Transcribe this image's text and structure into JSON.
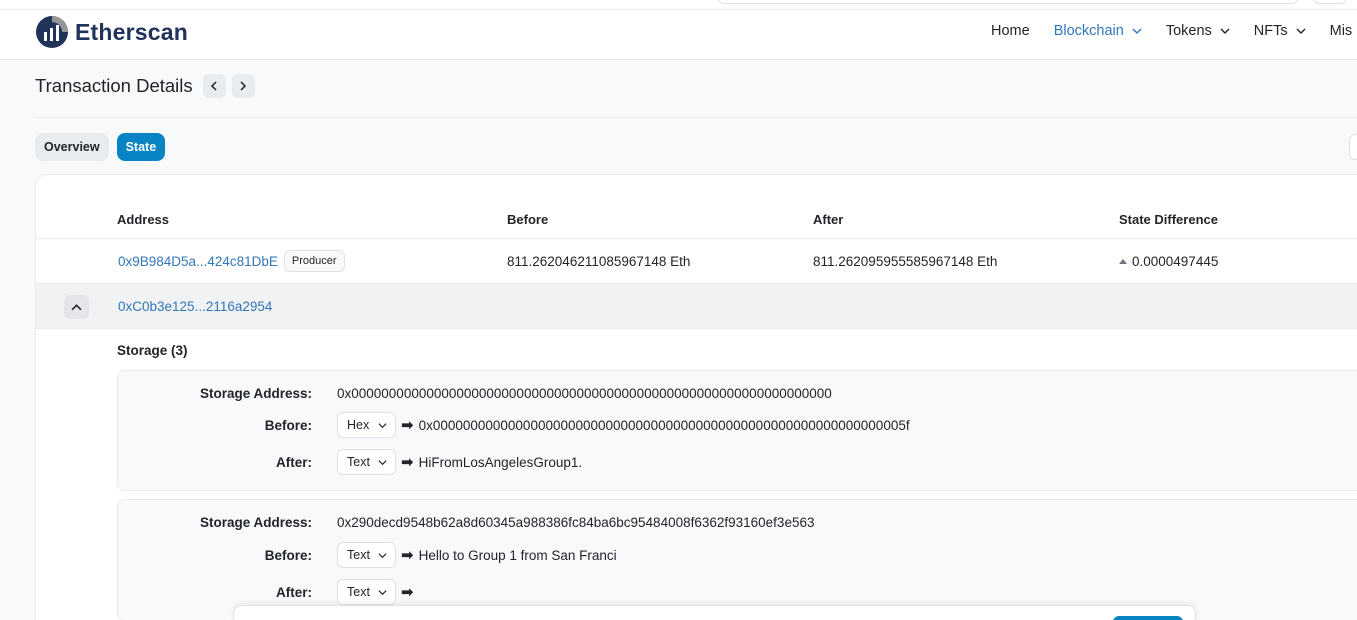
{
  "header": {
    "logo_text": "Etherscan",
    "nav": [
      {
        "label": "Home",
        "dropdown": false,
        "active": false
      },
      {
        "label": "Blockchain",
        "dropdown": true,
        "active": true
      },
      {
        "label": "Tokens",
        "dropdown": true,
        "active": false
      },
      {
        "label": "NFTs",
        "dropdown": true,
        "active": false
      },
      {
        "label": "Mis",
        "dropdown": false,
        "active": false
      }
    ]
  },
  "page": {
    "title": "Transaction Details"
  },
  "tabs": [
    {
      "label": "Overview",
      "active": false
    },
    {
      "label": "State",
      "active": true
    }
  ],
  "table": {
    "headers": {
      "address": "Address",
      "before": "Before",
      "after": "After",
      "diff": "State Difference"
    },
    "rows": [
      {
        "address": "0x9B984D5a...424c81DbE",
        "badge": "Producer",
        "before": "811.262046211085967148 Eth",
        "after": "811.262095955585967148 Eth",
        "diff": "0.0000497445"
      },
      {
        "address": "0xC0b3e125...2116a2954"
      }
    ]
  },
  "storage": {
    "title": "Storage (3)",
    "labels": {
      "address": "Storage Address:",
      "before": "Before:",
      "after": "After:"
    },
    "entries": [
      {
        "address": "0x0000000000000000000000000000000000000000000000000000000000000000",
        "before_format": "Hex",
        "before_value": "0x000000000000000000000000000000000000000000000000000000000000005f",
        "after_format": "Text",
        "after_value": "HiFromLosAngelesGroup1."
      },
      {
        "address": "0x290decd9548b62a8d60345a988386fc84ba6bc95484008f6362f93160ef3e563",
        "before_format": "Text",
        "before_value": "Hello to Group 1 from San Franci",
        "after_format": "Text",
        "after_value": ""
      }
    ]
  },
  "colors": {
    "accent": "#0784c3",
    "link": "#3277ba",
    "logo": "#21325b"
  },
  "icons": {
    "arrow": "➡"
  }
}
